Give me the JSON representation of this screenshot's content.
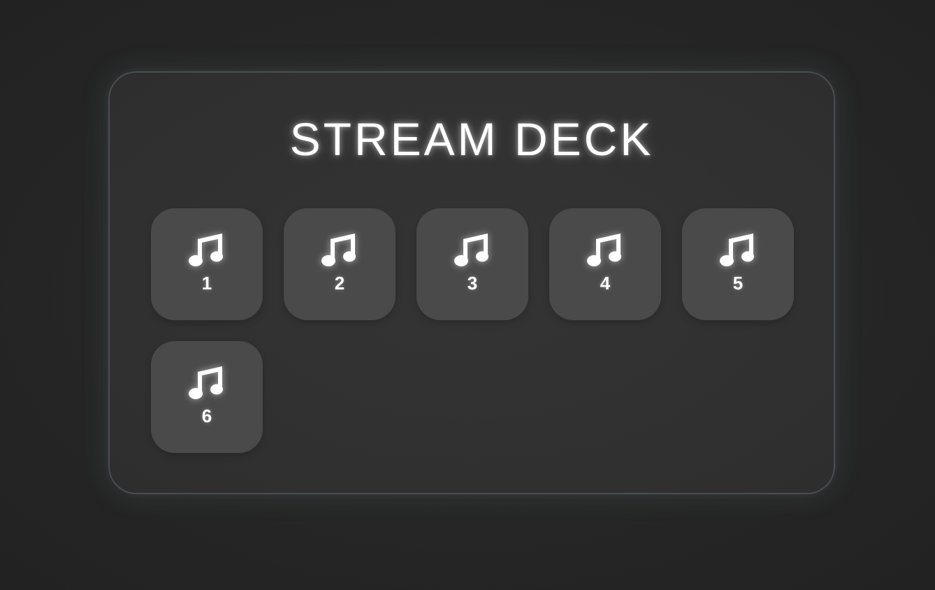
{
  "title": "STREAM DECK",
  "keys": [
    {
      "label": "1",
      "icon": "music-note-icon"
    },
    {
      "label": "2",
      "icon": "music-note-icon"
    },
    {
      "label": "3",
      "icon": "music-note-icon"
    },
    {
      "label": "4",
      "icon": "music-note-icon"
    },
    {
      "label": "5",
      "icon": "music-note-icon"
    },
    {
      "label": "6",
      "icon": "music-note-icon"
    }
  ],
  "colors": {
    "background": "#262626",
    "panel": "#333333",
    "panel_border": "#4a4e4e",
    "key": "#4a4a4a",
    "text": "#ffffff"
  }
}
